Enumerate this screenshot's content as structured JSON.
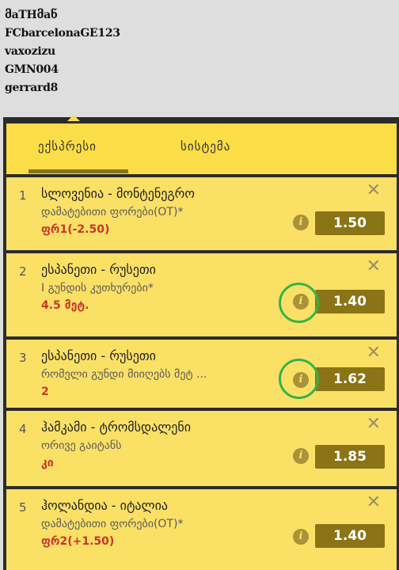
{
  "users": [
    "მaTHმaნ",
    "FCbarcelonaGE123",
    "vaxozizu",
    "GMN004",
    "gerrard8"
  ],
  "tabs": {
    "express": "ექსპრესი",
    "system": "სისტემა"
  },
  "close_symbol": "✕",
  "info_symbol": "i",
  "colors": {
    "panel_yellow": "#fbde47",
    "odds_bg": "#8a7416",
    "pick_red": "#c9352b",
    "highlight_green": "#35b24a"
  },
  "bets": [
    {
      "num": "1",
      "match": "სლოვენია - მონტენეგრო",
      "market": "დამატებითი ფორები(OT)*",
      "pick": "ფრ1(-2.50)",
      "odds": "1.50"
    },
    {
      "num": "2",
      "match": "ესპანეთი - რუსეთი",
      "market": "I გუნდის კუთხურები*",
      "pick": "4.5 მეტ.",
      "odds": "1.40"
    },
    {
      "num": "3",
      "match": "ესპანეთი - რუსეთი",
      "market": "რომელი გუნდი მიიღებს მეტ ...",
      "pick": "2",
      "odds": "1.62"
    },
    {
      "num": "4",
      "match": "ჰამკამი - ტრომსდალენი",
      "market": "ორივე გაიტანს",
      "pick": "კი",
      "odds": "1.85"
    },
    {
      "num": "5",
      "match": "ჰოლანდია - იტალია",
      "market": "დამატებითი ფორები(OT)*",
      "pick": "ფრ2(+1.50)",
      "odds": "1.40"
    }
  ]
}
